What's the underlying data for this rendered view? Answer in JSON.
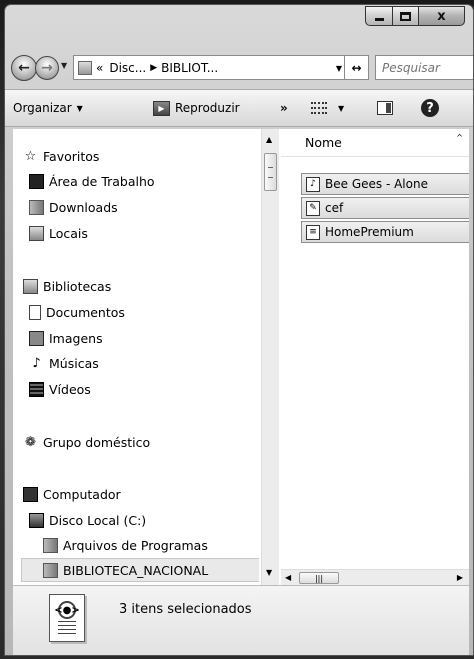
{
  "window": {
    "controls": {
      "minimize": "minimize",
      "maximize": "maximize",
      "close": "x"
    }
  },
  "address": {
    "overflow": "«",
    "crumbs": [
      "Disc...",
      "BIBLIOT..."
    ],
    "search_placeholder": "Pesquisar"
  },
  "toolbar": {
    "organize": "Organizar",
    "play": "Reproduzir",
    "more": "»"
  },
  "nav": {
    "favorites": {
      "label": "Favoritos",
      "items": [
        "Área de Trabalho",
        "Downloads",
        "Locais"
      ]
    },
    "libraries": {
      "label": "Bibliotecas",
      "items": [
        "Documentos",
        "Imagens",
        "Músicas",
        "Vídeos"
      ]
    },
    "homegroup": "Grupo doméstico",
    "computer": {
      "label": "Computador",
      "drive": "Disco Local (C:)",
      "folders": [
        "Arquivos de Programas",
        "BIBLIOTECA_NACIONAL"
      ],
      "selected": "BIBLIOTECA_NACIONAL"
    }
  },
  "files": {
    "column_name": "Nome",
    "items": [
      "Bee Gees - Alone",
      "cef",
      "HomePremium"
    ],
    "selected_count": 3
  },
  "details": {
    "status": "3 itens selecionados"
  }
}
